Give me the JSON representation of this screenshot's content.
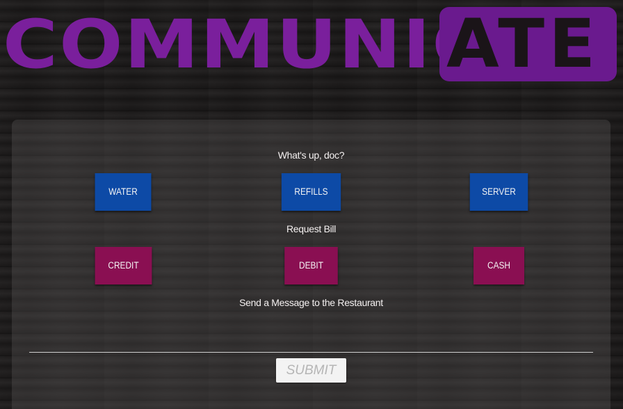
{
  "logo": {
    "main": "COMMUNIC",
    "box": "ATE"
  },
  "colors": {
    "brand_purple": "#7a1f9c",
    "blue_button": "#0d4aa6",
    "magenta_button": "#8a0f52"
  },
  "quick_requests": {
    "heading": "What's up, doc?",
    "buttons": [
      "WATER",
      "REFILLS",
      "SERVER"
    ]
  },
  "bill": {
    "heading": "Request Bill",
    "buttons": [
      "CREDIT",
      "DEBIT",
      "CASH"
    ]
  },
  "message": {
    "heading": "Send a Message to the Restaurant",
    "input_value": ""
  },
  "submit_label": "SUBMIT"
}
